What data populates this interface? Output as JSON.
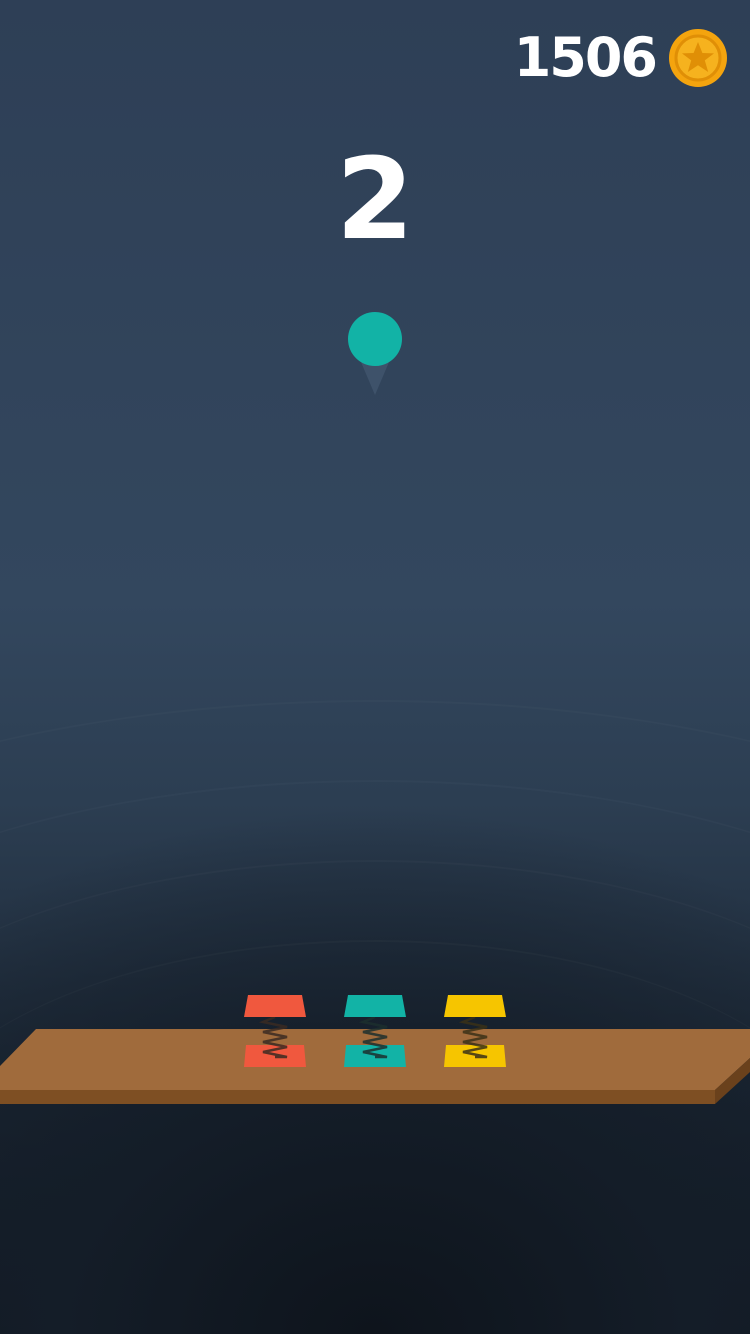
{
  "hud": {
    "coins": "1506",
    "coin_icon": "star-coin-icon",
    "score": "2"
  },
  "ball": {
    "color": "#12b3a6"
  },
  "springs": [
    {
      "name": "red-spring",
      "color": "#f0583e"
    },
    {
      "name": "teal-spring",
      "color": "#12b3a6"
    },
    {
      "name": "yellow-spring",
      "color": "#f6c500"
    }
  ],
  "platform": {
    "color": "#a06b3c"
  }
}
